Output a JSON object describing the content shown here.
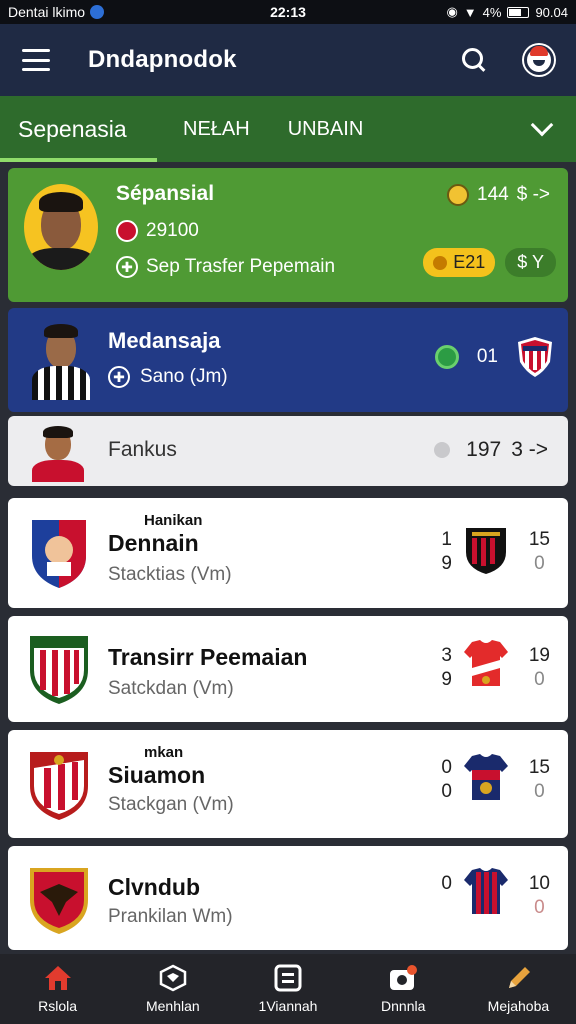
{
  "status_bar": {
    "left_text": "Dentai lkimo",
    "time": "22:13",
    "battery": "4%",
    "right_text": "90.04"
  },
  "app_bar": {
    "title": "Dndapnodok"
  },
  "tabs": [
    {
      "label": "Sepenasia"
    },
    {
      "label": "NEŁAH"
    },
    {
      "label": "UNBAIN"
    }
  ],
  "featured": {
    "name": "Sépansial",
    "value": "29100",
    "subtitle": "Sep Trasfer Pepemain",
    "right_value": "144",
    "right_currency": "$ ->",
    "pill_value": "E21",
    "pill_currency": "$ Y"
  },
  "blue_card": {
    "name": "Medansaja",
    "subtitle": "Sano (Jm)",
    "score": "01"
  },
  "light_card": {
    "name": "Fankus",
    "value": "197",
    "arrow": "3 ->"
  },
  "rows": [
    {
      "top_label": "Hanikan",
      "name": "Dennain",
      "subtitle": "Stacktias (Vm)",
      "a_top": "1",
      "a_bottom": "9",
      "b_top": "15",
      "b_bottom": "0"
    },
    {
      "top_label": "",
      "name": "Transirr Peemaian",
      "subtitle": "Satckdan (Vm)",
      "a_top": "3",
      "a_bottom": "9",
      "b_top": "19",
      "b_bottom": "0"
    },
    {
      "top_label": "mkan",
      "name": "Siuamon",
      "subtitle": "Stackgan (Vm)",
      "a_top": "0",
      "a_bottom": "0",
      "b_top": "15",
      "b_bottom": "0"
    },
    {
      "top_label": "",
      "name": "Clvndub",
      "subtitle": "Prankilan Wm)",
      "a_top": "0",
      "a_bottom": "",
      "b_top": "10",
      "b_bottom": "0"
    }
  ],
  "bottom_nav": [
    {
      "label": "Rslola",
      "icon": "home-icon"
    },
    {
      "label": "Menhlan",
      "icon": "kit-icon"
    },
    {
      "label": "1Viannah",
      "icon": "board-icon"
    },
    {
      "label": "Dnnnla",
      "icon": "camera-icon"
    },
    {
      "label": "Mejahoba",
      "icon": "pencil-icon"
    }
  ],
  "colors": {
    "app_bar": "#1f2a44",
    "tabs": "#2e6b2c",
    "featured": "#4f9a34",
    "blue_card": "#223a86",
    "accent": "#f4c21c"
  }
}
